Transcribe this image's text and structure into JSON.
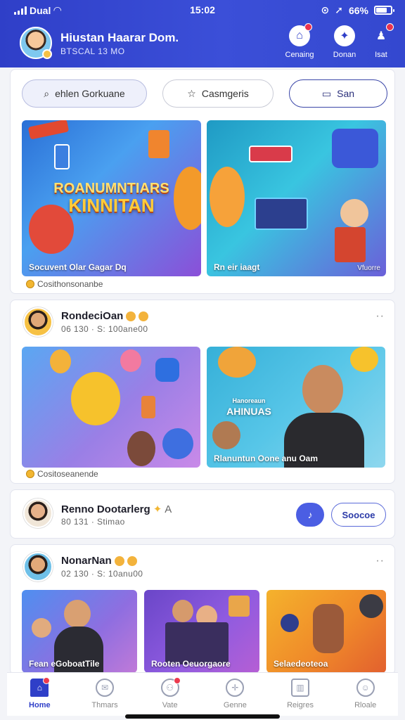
{
  "status_bar": {
    "carrier": "Dual",
    "time": "15:02",
    "battery": "66%",
    "battery_level": 0.66
  },
  "header": {
    "title": "Hiustan Haarar Dom.",
    "subtitle": "BTSCAL 13 MO",
    "actions": [
      {
        "label": "Cenaing",
        "icon": "home-icon",
        "badge": true
      },
      {
        "label": "Donan",
        "icon": "compass-icon",
        "badge": false
      },
      {
        "label": "Isat",
        "icon": "person-icon",
        "badge": true
      }
    ]
  },
  "chips": {
    "search": "ehlen Gorkuane",
    "categories": "Casmgeris",
    "scan": "San"
  },
  "featured": {
    "left": {
      "banner_top": "ROANUMNTIARS",
      "banner_bottom": "KINNITAN",
      "caption": "Socuvent Olar Gagar Dq"
    },
    "right": {
      "caption": "Rn eir iaagt",
      "caption_right": "Vfuorre"
    },
    "footer": "Cosithonsonanbe"
  },
  "posts": [
    {
      "name": "RondeciOan",
      "meta": "06 130 · S: 100ane00",
      "left_tile_caption": "",
      "right_tile_top": "Hanoreaun",
      "right_tile_mid": "AHINUAS",
      "right_tile_caption": "Rlanuntun Oone anu Oam",
      "footer": "Cositoseanende"
    },
    {
      "name": "Renno Dootarlerg",
      "meta": "80 131 · Stimao",
      "source_label": "Soocoe"
    },
    {
      "name": "NonarNan",
      "meta": "02 130 · S: 10anu00",
      "tiles": [
        {
          "caption": "Fean eGoboatTile"
        },
        {
          "caption": "Rooten Oeuorgaore"
        },
        {
          "caption": "Selaedeoteoa"
        }
      ]
    }
  ],
  "bottom_nav": [
    {
      "label": "Home",
      "icon": "home-icon",
      "active": true,
      "badge": true
    },
    {
      "label": "Thmars",
      "icon": "chat-icon",
      "active": false,
      "badge": false
    },
    {
      "label": "Vate",
      "icon": "people-icon",
      "active": false,
      "badge": true
    },
    {
      "label": "Genne",
      "icon": "game-icon",
      "active": false,
      "badge": false
    },
    {
      "label": "Reigres",
      "icon": "gift-icon",
      "active": false,
      "badge": false
    },
    {
      "label": "Rloale",
      "icon": "profile-icon",
      "active": false,
      "badge": false
    }
  ],
  "colors": {
    "brand": "#2f3fc8",
    "accent": "#4b5ee3",
    "badge": "#ec3b4f",
    "background": "#f3f4f8"
  }
}
